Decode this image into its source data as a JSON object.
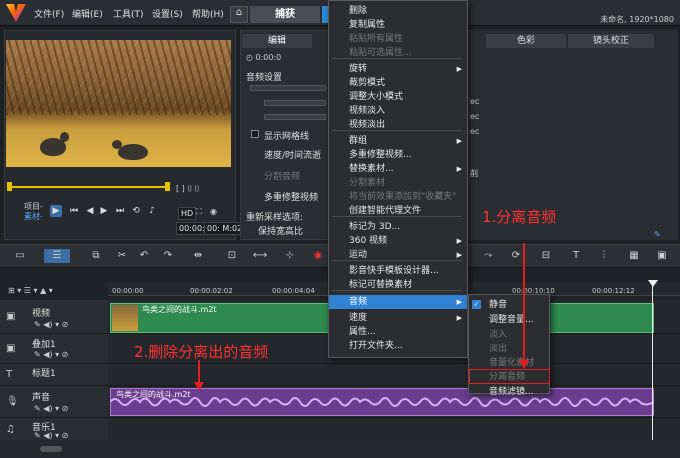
{
  "menubar": {
    "menus": [
      "文件(F)",
      "编辑(E)",
      "工具(T)",
      "设置(S)",
      "帮助(H)"
    ],
    "tab_capture": "捕获",
    "project_name": "未命名, 1920*1080"
  },
  "preview": {
    "project_label": "项目-",
    "clip_label": "素材-",
    "timecode_left": "00:00:0",
    "timecode_right": "00: M:02",
    "zoom_label": "HD"
  },
  "options": {
    "tab_edit": "编辑",
    "audio_settings": "音频设置",
    "show_grid": "显示网格线",
    "speed_time": "速度/时间流逝",
    "split_audio": "分割音频",
    "multicam": "多重修整视频",
    "resample": "重新采样选项:",
    "resample_value": "保持宽高比"
  },
  "right_panel": {
    "tab_color": "色彩",
    "tab_lens": "镜头校正",
    "partial_chars": [
      "ec",
      "ec",
      "ec",
      "削"
    ]
  },
  "context_menu": {
    "items": [
      {
        "label": "删除",
        "disabled": false
      },
      {
        "label": "复制属性",
        "disabled": false
      },
      {
        "label": "粘贴所有属性",
        "disabled": true
      },
      {
        "label": "粘贴可选属性...",
        "disabled": true
      },
      {
        "label": "旋转",
        "disabled": false,
        "submenu": true
      },
      {
        "label": "裁剪模式",
        "disabled": false
      },
      {
        "label": "调整大小模式",
        "disabled": false
      },
      {
        "label": "视频淡入",
        "disabled": false
      },
      {
        "label": "视频淡出",
        "disabled": false
      },
      {
        "label": "群组",
        "disabled": false,
        "submenu": true
      },
      {
        "label": "多重修整视频...",
        "disabled": false
      },
      {
        "label": "替换素材...",
        "disabled": false,
        "submenu": true
      },
      {
        "label": "分割素材",
        "disabled": true
      },
      {
        "label": "将当前效果添加到\"收藏夹\"",
        "disabled": true
      },
      {
        "label": "创建智能代理文件",
        "disabled": false
      },
      {
        "label": "标记为 3D...",
        "disabled": false
      },
      {
        "label": "360 视频",
        "disabled": false,
        "submenu": true
      },
      {
        "label": "运动",
        "disabled": false,
        "submenu": true
      },
      {
        "label": "影音快手模板设计器...",
        "disabled": false
      },
      {
        "label": "标记可替换素材",
        "disabled": false
      },
      {
        "label": "音频",
        "disabled": false,
        "submenu": true,
        "highlighted": true
      },
      {
        "label": "速度",
        "disabled": false,
        "submenu": true
      },
      {
        "label": "属性...",
        "disabled": false
      },
      {
        "label": "打开文件夹...",
        "disabled": false
      }
    ]
  },
  "audio_submenu": {
    "items": [
      {
        "label": "静音",
        "disabled": false,
        "checked": true
      },
      {
        "label": "调整音量...",
        "disabled": false
      },
      {
        "label": "淡入",
        "disabled": true
      },
      {
        "label": "淡出",
        "disabled": true
      },
      {
        "label": "音量化素材",
        "disabled": true
      },
      {
        "label": "分离音频",
        "disabled": true
      },
      {
        "label": "音频滤镜...",
        "disabled": false
      }
    ]
  },
  "annotations": {
    "step1": "1.分离音频",
    "step2": "2.删除分离出的音频"
  },
  "ruler": {
    "ticks": [
      "00:00:00",
      "00:00:02:02",
      "00:00:04:04",
      "00:00:10:10",
      "00:00:12:12"
    ]
  },
  "tracks": [
    {
      "name": "视频",
      "type": "video"
    },
    {
      "name": "叠加1",
      "type": "overlay"
    },
    {
      "name": "标题1",
      "type": "title"
    },
    {
      "name": "声音",
      "type": "voice"
    },
    {
      "name": "音乐1",
      "type": "music"
    }
  ],
  "clips": {
    "video_clip_name": "鸟类之间的战斗.m2t",
    "audio_clip_name": "鸟类之间的战斗.m2t"
  },
  "colors": {
    "accent": "#2f82d4",
    "annotation": "#ff3030",
    "video_clip": "#2e8a4e",
    "audio_clip": "#6a3d8f"
  }
}
